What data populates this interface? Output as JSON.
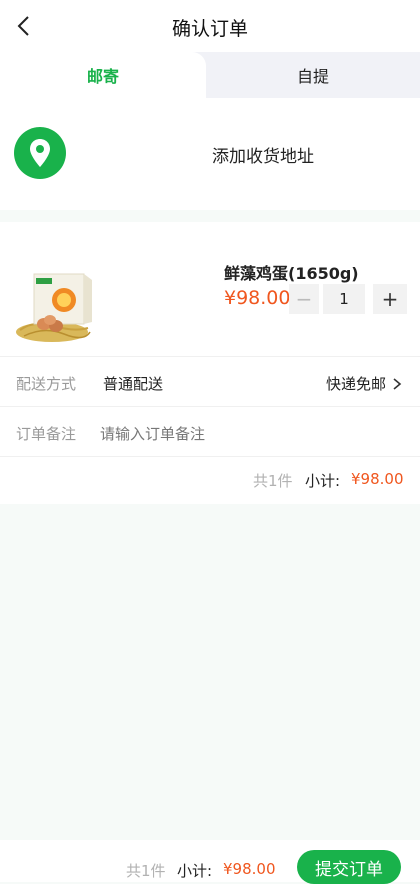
{
  "header": {
    "title": "确认订单"
  },
  "tabs": [
    {
      "label": "邮寄"
    },
    {
      "label": "自提"
    }
  ],
  "address": {
    "prompt": "添加收货地址"
  },
  "product": {
    "name": "鲜藻鸡蛋(1650g)",
    "price": "¥98.00",
    "quantity": "1",
    "minus": "−",
    "plus": "+"
  },
  "delivery": {
    "label": "配送方式",
    "value": "普通配送",
    "shipping": "快递免邮"
  },
  "remark": {
    "label": "订单备注",
    "placeholder": "请输入订单备注"
  },
  "summary": {
    "count": "共1件",
    "subtotal_label": "小计:",
    "subtotal": "¥98.00"
  },
  "bottom": {
    "count": "共1件",
    "subtotal_label": "小计:",
    "subtotal": "¥98.00",
    "submit": "提交订单"
  },
  "colors": {
    "brand": "#19b24b",
    "price": "#f0571f"
  }
}
